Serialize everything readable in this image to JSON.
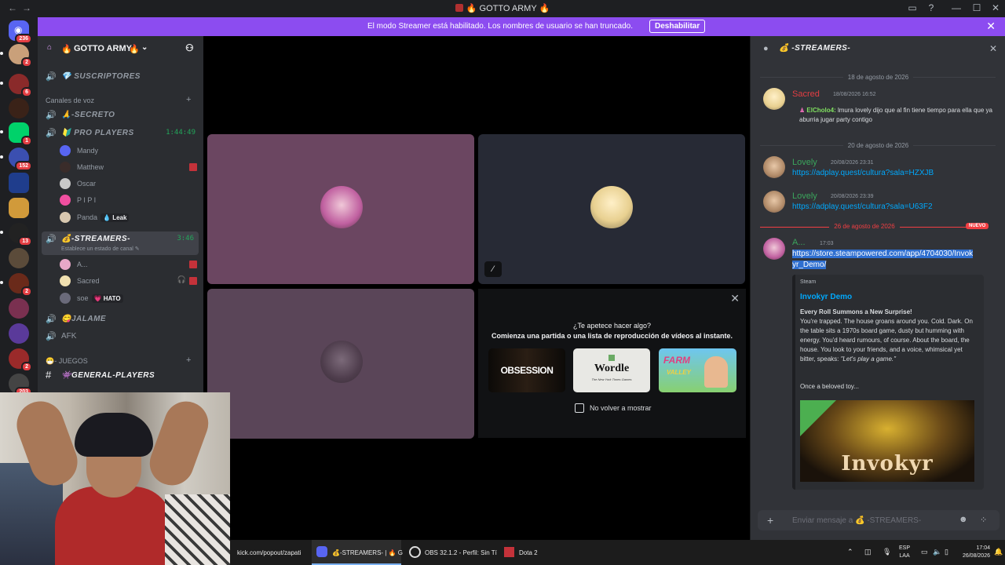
{
  "titlebar": {
    "back": "←",
    "forward": "→",
    "title": "🔥 GOTTO ARMY 🔥"
  },
  "banner": {
    "message": "El modo Streamer está habilitado. Los nombres de usuario se han truncado.",
    "button": "Deshabilitar"
  },
  "rail": {
    "home_badge": "236",
    "servers": [
      {
        "badge": "2"
      },
      {
        "badge": "6"
      },
      {
        "badge": ""
      },
      {
        "badge": "1"
      },
      {
        "badge": "152"
      },
      {
        "badge": ""
      },
      {
        "badge": ""
      },
      {
        "badge": "13"
      },
      {
        "badge": ""
      },
      {
        "badge": "2"
      },
      {
        "badge": ""
      },
      {
        "badge": ""
      },
      {
        "badge": "2"
      },
      {
        "badge": "203"
      }
    ]
  },
  "sidebar": {
    "server_name": "GOTTO ARMY",
    "channels_top": [
      {
        "label": "SUSCRIPTORES",
        "emoji": "💎"
      }
    ],
    "voice_category": "Canales de voz",
    "voice": [
      {
        "label": "-SECRETO",
        "emoji": "🙏"
      },
      {
        "label": "PRO PLAYERS",
        "emoji": "🔰",
        "timer": "1:44:49"
      }
    ],
    "pro_members": [
      {
        "name": "Mandy"
      },
      {
        "name": "Matthew"
      },
      {
        "name": "Oscar"
      },
      {
        "name": "P I P I"
      },
      {
        "name": "Panda",
        "tag": "Leak"
      }
    ],
    "streamers": {
      "label": "-STREAMERS-",
      "emoji": "💰",
      "timer": "3:46",
      "status": "Establece un estado de canal"
    },
    "stream_members": [
      {
        "name": "A..."
      },
      {
        "name": "Sacred"
      },
      {
        "name": "soe",
        "tag": "HATO"
      }
    ],
    "voice_more": [
      {
        "label": "JALAME",
        "emoji": "😋"
      },
      {
        "label": "AFK",
        "emoji": ""
      }
    ],
    "games_category": "- JUEGOS",
    "text": [
      {
        "label": "GENERAL-PLAYERS",
        "emoji": "👾"
      }
    ]
  },
  "activity": {
    "title": "¿Te apetece hacer algo?",
    "subtitle": "Comienza una partida o una lista de reproducción de vídeos al instante.",
    "games": [
      "OBSESSION",
      "Wordle",
      "FARM"
    ],
    "wordle_sub": "The New York Times Games",
    "farm_sub": "VALLEY",
    "checkbox": "No volver a mostrar"
  },
  "chat": {
    "channel": "-STREAMERS-",
    "days": [
      "18 de agosto de 2026",
      "20 de agosto de 2026",
      "26 de agosto de 2026"
    ],
    "new_badge": "NUEVO",
    "messages": [
      {
        "name": "Sacred",
        "time": "18/08/2026 16:52",
        "reply_to": "ElCholo4:",
        "text": "lmura lovely dijo que al fin tiene tiempo para ella que ya aburria jugar party contigo"
      },
      {
        "name": "Lovely",
        "time": "20/08/2026 23:31",
        "link": "https://adplay.quest/cultura?sala=HZXJB"
      },
      {
        "name": "Lovely",
        "time": "20/08/2026 23:39",
        "link": "https://adplay.quest/cultura?sala=U63F2"
      },
      {
        "name": "A...",
        "time": "17:03",
        "link1": "https://store.steampowered.com/app/4704030/Invok",
        "link2": "yr_Demo/"
      }
    ],
    "embed": {
      "provider": "Steam",
      "title": "Invokyr Demo",
      "heading": "Every Roll Summons a New Surprise!",
      "body": "You're trapped. The house groans around you. Cold. Dark. On the table sits a 1970s board game, dusty but humming with energy. You'd heard rumours, of course. About the board, the house. You look to your friends, and a voice, whimsical yet bitter, speaks:",
      "quote": "\"Let's play a game.\"",
      "more": "Once a beloved toy...",
      "image_text": "Invokyr"
    },
    "composer_placeholder": "Enviar mensaje a 💰 -STREAMERS-"
  },
  "taskbar": {
    "apps": [
      "kick.com/popout/zapati",
      "💰-STREAMERS- | 🔥 G",
      "OBS 32.1.2 - Perfil: Sin Tí",
      "Dota 2"
    ],
    "lang1": "ESP",
    "lang2": "LAA",
    "time": "17:04",
    "date": "26/08/2026"
  }
}
